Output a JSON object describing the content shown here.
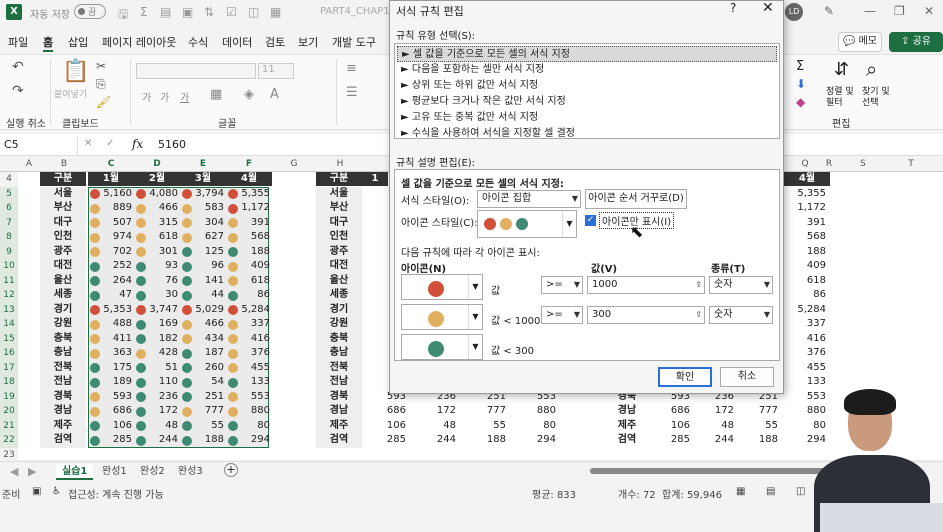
{
  "titlebar": {
    "logo": "X",
    "autosave_label": "자동 저장",
    "autosave_state": "끔",
    "doc_name": "PART4_CHAP1_0...",
    "avatar": "LD"
  },
  "menu": {
    "items": [
      "파일",
      "홈",
      "삽입",
      "페이지 레이아웃",
      "수식",
      "데이터",
      "검토",
      "보기",
      "개발 도구"
    ],
    "active": "홈",
    "memo": "메모",
    "share": "공유"
  },
  "ribbon": {
    "groups": [
      "실행 취소",
      "클립보드",
      "글꼴",
      "편집"
    ],
    "paste_label": "붙여넣기",
    "font_size": "11",
    "font_small": [
      "가",
      "가",
      "가"
    ],
    "sort_filter": "정렬 및\n필터",
    "find_select": "찾기 및\n선택",
    "sigma": "Σ"
  },
  "formula_bar": {
    "name_box": "C5",
    "fx": "fx",
    "value": "5160"
  },
  "columns": [
    "A",
    "B",
    "C",
    "D",
    "E",
    "F",
    "G",
    "H",
    "",
    "",
    "",
    "",
    "Q",
    "R",
    "S",
    "T"
  ],
  "rows": [
    "4",
    "5",
    "6",
    "7",
    "8",
    "9",
    "10",
    "11",
    "12",
    "13",
    "14",
    "15",
    "16",
    "17",
    "18",
    "19",
    "20",
    "21",
    "22",
    "23"
  ],
  "table1": {
    "headers": [
      "구분",
      "1월",
      "2월",
      "3월",
      "4월"
    ],
    "regions": [
      "서울",
      "부산",
      "대구",
      "인천",
      "광주",
      "대전",
      "울산",
      "세종",
      "경기",
      "강원",
      "충북",
      "충남",
      "전북",
      "전남",
      "경북",
      "경남",
      "제주",
      "검역"
    ],
    "values": [
      [
        5160,
        4080,
        3794,
        5355
      ],
      [
        889,
        466,
        583,
        1172
      ],
      [
        507,
        315,
        304,
        391
      ],
      [
        974,
        618,
        627,
        568
      ],
      [
        702,
        301,
        125,
        188
      ],
      [
        252,
        93,
        96,
        409
      ],
      [
        264,
        76,
        141,
        618
      ],
      [
        47,
        30,
        44,
        86
      ],
      [
        5353,
        3747,
        5029,
        5284
      ],
      [
        488,
        169,
        466,
        337
      ],
      [
        411,
        182,
        434,
        416
      ],
      [
        363,
        428,
        187,
        376
      ],
      [
        175,
        51,
        260,
        455
      ],
      [
        189,
        110,
        54,
        133
      ],
      [
        593,
        236,
        251,
        553
      ],
      [
        686,
        172,
        777,
        880
      ],
      [
        106,
        48,
        55,
        80
      ],
      [
        285,
        244,
        188,
        294
      ]
    ]
  },
  "table2": {
    "headers": [
      "구분",
      "1"
    ],
    "regions": [
      "서울",
      "부산",
      "대구",
      "인천",
      "광주",
      "대전",
      "울산",
      "세종",
      "경기",
      "강원",
      "충북",
      "충남",
      "전북",
      "전남",
      "경북",
      "경남",
      "제주",
      "검역"
    ],
    "partial_values": [
      [
        "",
        "",
        "",
        ""
      ],
      [
        "",
        "",
        "",
        ""
      ],
      [
        "",
        "",
        "",
        ""
      ],
      [
        "",
        "",
        "",
        ""
      ],
      [
        "",
        "",
        "",
        ""
      ],
      [
        "",
        "",
        "",
        ""
      ],
      [
        "",
        "",
        "",
        ""
      ],
      [
        "",
        "",
        "",
        ""
      ],
      [
        "5,",
        "",
        "",
        ""
      ],
      [
        "",
        "",
        "",
        ""
      ],
      [
        "",
        "",
        "",
        ""
      ],
      [
        "",
        "",
        "",
        ""
      ],
      [
        "",
        "",
        "",
        ""
      ],
      [
        "",
        "",
        "",
        ""
      ],
      [
        "593",
        "236",
        "251",
        "553"
      ],
      [
        "686",
        "172",
        "777",
        "880"
      ],
      [
        "106",
        "48",
        "55",
        "80"
      ],
      [
        "285",
        "244",
        "188",
        "294"
      ]
    ]
  },
  "table3": {
    "header": "4월",
    "values": [
      "5,355",
      "1,172",
      "391",
      "568",
      "188",
      "409",
      "618",
      "86",
      "5,284",
      "337",
      "416",
      "376",
      "455",
      "133",
      "553",
      "880",
      "80",
      "294"
    ],
    "lower_regions": [
      "경북",
      "경남",
      "제주",
      "검역"
    ],
    "lower_values": [
      [
        "593",
        "236",
        "251"
      ],
      [
        "686",
        "172",
        "777"
      ],
      [
        "106",
        "48",
        "55"
      ],
      [
        "285",
        "244",
        "188"
      ]
    ]
  },
  "sheet_tabs": [
    "실습1",
    "완성1",
    "완성2",
    "완성3"
  ],
  "active_sheet": "실습1",
  "add_sheet": "+",
  "status": {
    "ready": "준비",
    "accessibility": "접근성: 계속 진행 가능",
    "average": "평균: 833",
    "count": "개수: 72",
    "sum": "합계: 59,946"
  },
  "dialog": {
    "title": "서식 규칙 편집",
    "help": "?",
    "close": "✕",
    "rule_type_label": "규칙 유형 선택(S):",
    "rule_types": [
      "► 셀 값을 기준으로 모든 셀의 서식 지정",
      "► 다음을 포함하는 셀만 서식 지정",
      "► 상위 또는 하위 값만 서식 지정",
      "► 평균보다 크거나 작은 값만 서식 지정",
      "► 고유 또는 중복 값만 서식 지정",
      "► 수식을 사용하여 서식을 지정할 셀 결정"
    ],
    "rule_desc_label": "규칙 설명 편집(E):",
    "desc_heading": "셀 값을 기준으로 모든 셀의 서식 지정:",
    "format_style_label": "서식 스타일(O):",
    "format_style_value": "아이콘 집합",
    "reverse_button": "아이콘 순서 거꾸로(D)",
    "icon_style_label": "아이콘 스타일(C):",
    "show_icon_only": "아이콘만 표시(I)",
    "display_rule_label": "다음 규칙에 따라 각 아이콘 표시:",
    "col_icon": "아이콘(N)",
    "col_value": "값(V)",
    "col_type": "종류(T)",
    "rows": [
      {
        "condition": "값",
        "op": ">=",
        "value": "1000",
        "type": "숫자"
      },
      {
        "condition": "값 < 1000",
        "op": ">=",
        "value": "300",
        "type": "숫자"
      },
      {
        "condition": "값 < 300",
        "op": "",
        "value": "",
        "type": ""
      }
    ],
    "ok": "확인",
    "cancel": "취소"
  },
  "colors": {
    "accent": "#1d6f42",
    "red": "#d0503a",
    "amber": "#e0b060",
    "teal": "#3f8a72"
  }
}
